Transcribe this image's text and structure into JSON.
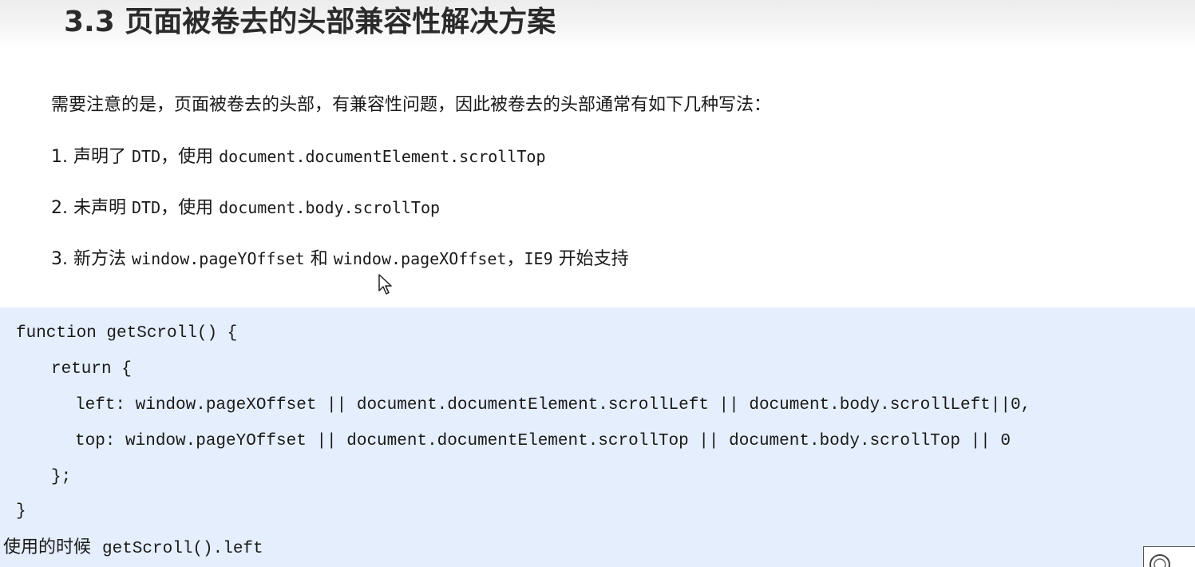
{
  "title": "3.3 页面被卷去的头部兼容性解决方案",
  "intro": "需要注意的是，页面被卷去的头部，有兼容性问题，因此被卷去的头部通常有如下几种写法：",
  "items": [
    {
      "prefix": "1. 声明了 ",
      "code1": "DTD",
      "middle": "，使用 ",
      "code2": "document.documentElement.scrollTop"
    },
    {
      "prefix": "2. 未声明 ",
      "code1": "DTD",
      "middle": "，使用 ",
      "code2": "document.body.scrollTop"
    },
    {
      "prefix": "3. 新方法 ",
      "code1": "window.pageYOffset",
      "middle": " 和 ",
      "code2": "window.pageXOffset",
      "sep": "，",
      "code3": "IE9",
      "suffix": " 开始支持"
    }
  ],
  "code_lines": [
    "function getScroll() {",
    "return {",
    "left: window.pageXOffset || document.documentElement.scrollLeft || document.body.scrollLeft||0,",
    "top: window.pageYOffset || document.documentElement.scrollTop || document.body.scrollTop || 0",
    "};",
    "}"
  ],
  "usage": {
    "label": "使用的时候  ",
    "code": "getScroll().left"
  },
  "colors": {
    "code_background": "#e4eefc",
    "title": "#2b2b2b"
  },
  "icons": {
    "cursor": "mouse-pointer-icon"
  }
}
